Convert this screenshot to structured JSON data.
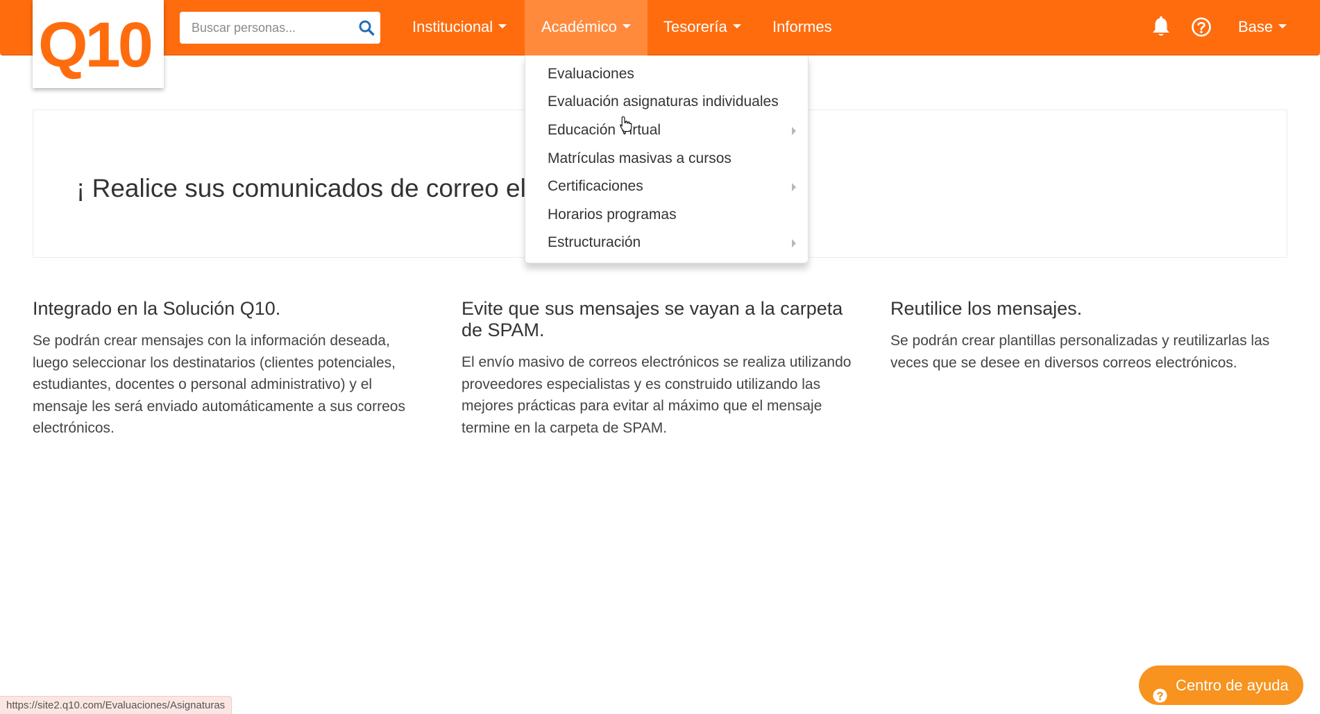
{
  "brand": {
    "logo_text": "Q10",
    "primary_color": "#ff6c0e",
    "active_nav_color": "#ff8a3c"
  },
  "search": {
    "placeholder": "Buscar personas...",
    "value": "",
    "icon": "search-icon"
  },
  "nav": {
    "items": [
      {
        "label": "Institucional",
        "has_caret": true,
        "active": false
      },
      {
        "label": "Académico",
        "has_caret": true,
        "active": true
      },
      {
        "label": "Tesorería",
        "has_caret": true,
        "active": false
      },
      {
        "label": "Informes",
        "has_caret": false,
        "active": false
      }
    ],
    "icons": [
      "bell-icon",
      "help-circle-icon"
    ],
    "user": {
      "label": "Base",
      "has_caret": true
    }
  },
  "dropdown": {
    "items": [
      {
        "label": "Evaluaciones",
        "has_submenu": false
      },
      {
        "label": "Evaluación asignaturas individuales",
        "has_submenu": false
      },
      {
        "label": "Educación Virtual",
        "has_submenu": true
      },
      {
        "label": "Matrículas masivas a cursos",
        "has_submenu": false
      },
      {
        "label": "Certificaciones",
        "has_submenu": true
      },
      {
        "label": "Horarios programas",
        "has_submenu": false
      },
      {
        "label": "Estructuración",
        "has_submenu": true
      }
    ]
  },
  "banner": {
    "text": "¡ Realice sus comunicados de correo ele"
  },
  "features": [
    {
      "title": "Integrado en la Solución Q10.",
      "body": "Se podrán crear mensajes con la información deseada, luego seleccionar los destinatarios (clientes potenciales, estudiantes, docentes o personal administrativo) y el mensaje les será enviado automáticamente a sus correos electrónicos."
    },
    {
      "title": "Evite que sus mensajes se vayan a la carpeta de SPAM.",
      "body": "El envío masivo de correos electrónicos se realiza utilizando proveedores especialistas y es construido utilizando las mejores prácticas para evitar al máximo que el mensaje termine en la carpeta de SPAM."
    },
    {
      "title": "Reutilice los mensajes.",
      "body": "Se podrán crear plantillas personalizadas y reutilizarlas las veces que se desee en diversos correos electrónicos."
    }
  ],
  "status_bar": {
    "url": "https://site2.q10.com/Evaluaciones/Asignaturas"
  },
  "help_center": {
    "label": "Centro de ayuda",
    "color": "#f7931e"
  }
}
